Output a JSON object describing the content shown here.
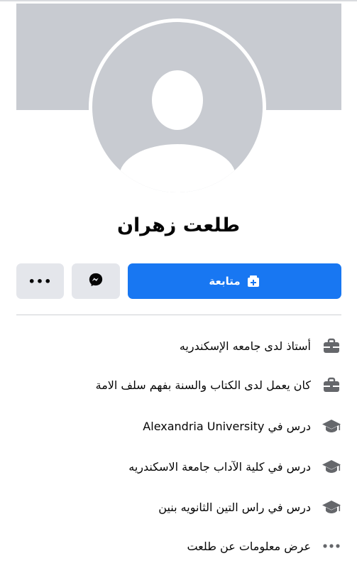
{
  "profile": {
    "name": "طلعت زهران"
  },
  "actions": {
    "follow_label": "متابعة",
    "more_label": "•••"
  },
  "info_items": [
    {
      "text": "أستاذ لدى جامعه الإسكندريه",
      "icon": "briefcase-icon"
    },
    {
      "text": "كان يعمل لدى الكتاب والسنة بفهم سلف الامة",
      "icon": "briefcase-icon"
    },
    {
      "text": "درس في Alexandria University",
      "icon": "graduation-cap-icon"
    },
    {
      "text": "درس في كلية الآداب جامعة الاسكندريه",
      "icon": "graduation-cap-icon"
    },
    {
      "text": "درس في راس التين الثانويه بنين",
      "icon": "graduation-cap-icon"
    },
    {
      "text": "عرض معلومات عن طلعت",
      "icon": "more-dots-icon"
    }
  ],
  "colors": {
    "primary": "#1877f2",
    "secondary_button": "#e4e6eb",
    "placeholder": "#c8cbd1",
    "icon": "#65676b"
  }
}
